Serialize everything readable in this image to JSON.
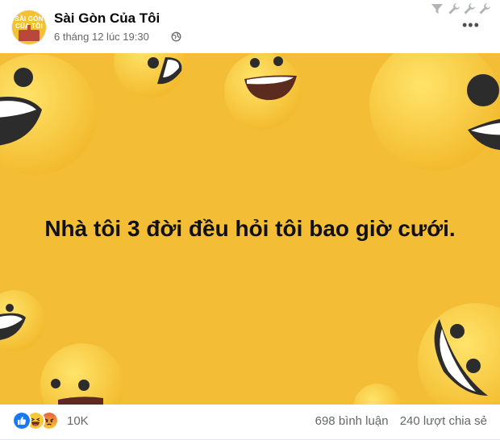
{
  "post": {
    "page_name": "Sài Gòn Của Tôi",
    "timestamp": "6 tháng 12 lúc 19:30",
    "privacy_icon": "globe-icon",
    "avatar_text_line1": "SÀI GÒN",
    "avatar_text_line2": "CỦA TÔI"
  },
  "toolbar": {
    "icons": [
      "filter-icon",
      "wrench-icon",
      "wrench-icon",
      "wrench-icon"
    ],
    "more_icon": "•••"
  },
  "image": {
    "caption": "Nhà tôi 3 đời đều hỏi tôi bao giờ cưới.",
    "background_color": "#f3bd36"
  },
  "footer": {
    "reactions": [
      "like",
      "haha",
      "angry"
    ],
    "reaction_count": "10K",
    "comments": "698 bình luận",
    "shares": "240 lượt chia sẻ"
  }
}
